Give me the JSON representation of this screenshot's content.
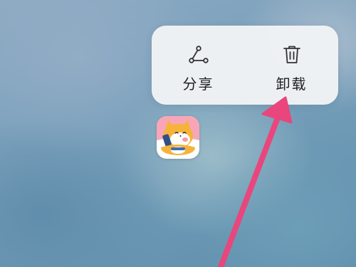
{
  "context_menu": {
    "items": [
      {
        "label": "分享",
        "icon": "share-icon"
      },
      {
        "label": "卸载",
        "icon": "trash-icon"
      }
    ]
  },
  "app": {
    "icon": "shiba-cat-app-icon",
    "background_color": "#f7a6b8"
  },
  "annotation": {
    "arrow_color": "#e8467c"
  }
}
